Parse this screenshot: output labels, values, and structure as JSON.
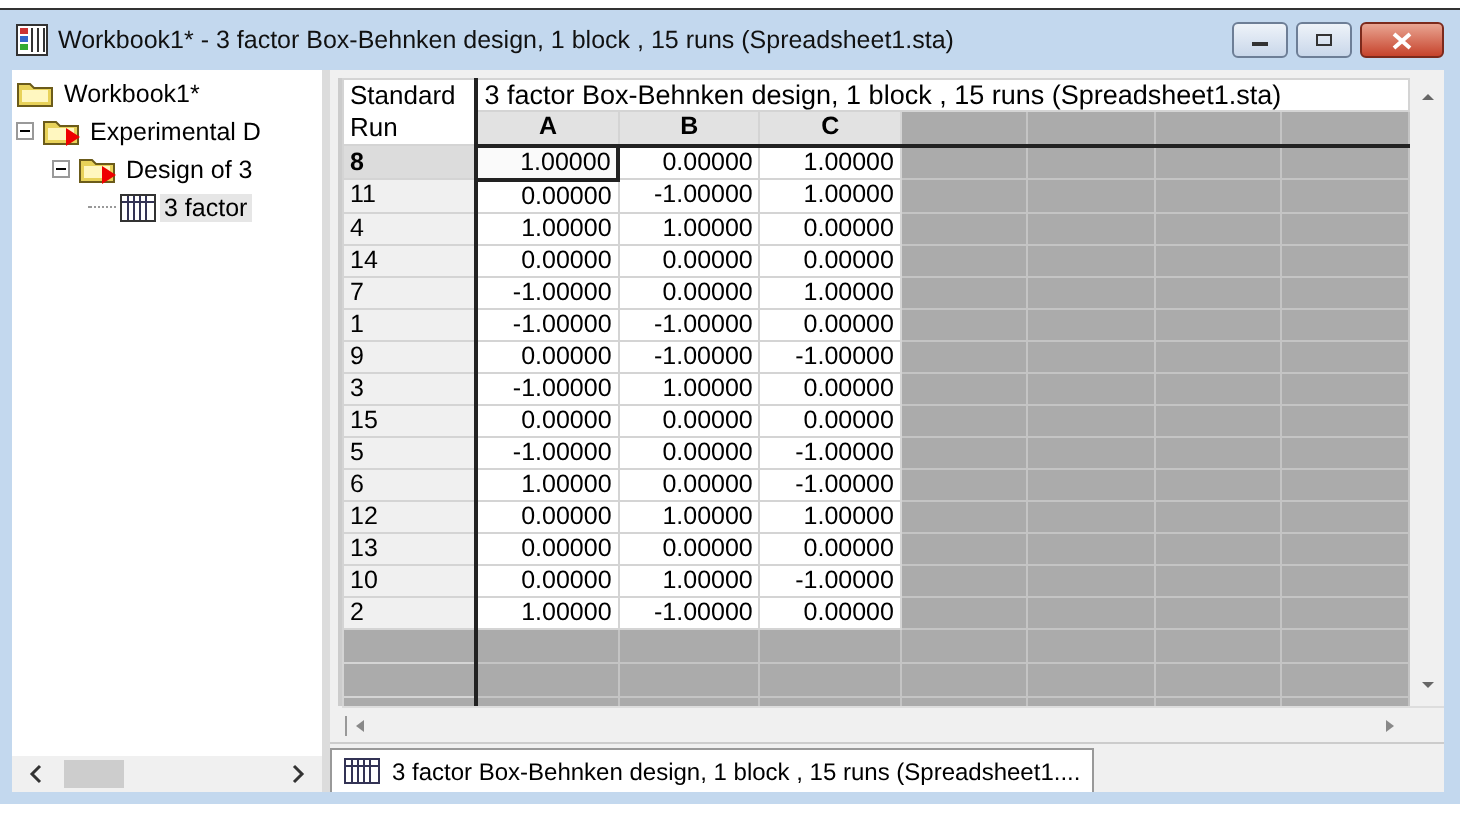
{
  "window": {
    "title": "Workbook1* - 3 factor Box-Behnken design, 1 block , 15 runs (Spreadsheet1.sta)"
  },
  "tree": [
    {
      "label": "Workbook1*",
      "kind": "folder",
      "selected": false,
      "children": [
        {
          "label": "Experimental D",
          "kind": "design",
          "expanded": true,
          "selected": false,
          "children": [
            {
              "label": "Design of 3",
              "kind": "design",
              "expanded": true,
              "selected": false,
              "children": [
                {
                  "label": "3 factor",
                  "kind": "sheet",
                  "selected": true
                }
              ]
            }
          ]
        }
      ]
    }
  ],
  "table": {
    "corner": [
      "Standard",
      "Run"
    ],
    "title": "3 factor Box-Behnken design, 1 block , 15 runs (Spreadsheet1.sta)",
    "columns": [
      "A",
      "B",
      "C"
    ],
    "rows": [
      {
        "label": "8",
        "cells": [
          {
            "value": "1.00000",
            "selected": true
          },
          {
            "value": "0.00000",
            "selected": false
          },
          {
            "value": "1.00000",
            "selected": false
          }
        ]
      },
      {
        "label": "11",
        "cells": [
          {
            "value": "0.00000",
            "selected": false
          },
          {
            "value": "-1.00000",
            "selected": false
          },
          {
            "value": "1.00000",
            "selected": false
          }
        ]
      },
      {
        "label": "4",
        "cells": [
          {
            "value": "1.00000",
            "selected": false
          },
          {
            "value": "1.00000",
            "selected": false
          },
          {
            "value": "0.00000",
            "selected": false
          }
        ]
      },
      {
        "label": "14",
        "cells": [
          {
            "value": "0.00000",
            "selected": false
          },
          {
            "value": "0.00000",
            "selected": false
          },
          {
            "value": "0.00000",
            "selected": false
          }
        ]
      },
      {
        "label": "7",
        "cells": [
          {
            "value": "-1.00000",
            "selected": false
          },
          {
            "value": "0.00000",
            "selected": false
          },
          {
            "value": "1.00000",
            "selected": false
          }
        ]
      },
      {
        "label": "1",
        "cells": [
          {
            "value": "-1.00000",
            "selected": false
          },
          {
            "value": "-1.00000",
            "selected": false
          },
          {
            "value": "0.00000",
            "selected": false
          }
        ]
      },
      {
        "label": "9",
        "cells": [
          {
            "value": "0.00000",
            "selected": false
          },
          {
            "value": "-1.00000",
            "selected": false
          },
          {
            "value": "-1.00000",
            "selected": false
          }
        ]
      },
      {
        "label": "3",
        "cells": [
          {
            "value": "-1.00000",
            "selected": false
          },
          {
            "value": "1.00000",
            "selected": false
          },
          {
            "value": "0.00000",
            "selected": false
          }
        ]
      },
      {
        "label": "15",
        "cells": [
          {
            "value": "0.00000",
            "selected": false
          },
          {
            "value": "0.00000",
            "selected": false
          },
          {
            "value": "0.00000",
            "selected": false
          }
        ]
      },
      {
        "label": "5",
        "cells": [
          {
            "value": "-1.00000",
            "selected": false
          },
          {
            "value": "0.00000",
            "selected": false
          },
          {
            "value": "-1.00000",
            "selected": false
          }
        ]
      },
      {
        "label": "6",
        "cells": [
          {
            "value": "1.00000",
            "selected": false
          },
          {
            "value": "0.00000",
            "selected": false
          },
          {
            "value": "-1.00000",
            "selected": false
          }
        ]
      },
      {
        "label": "12",
        "cells": [
          {
            "value": "0.00000",
            "selected": false
          },
          {
            "value": "1.00000",
            "selected": false
          },
          {
            "value": "1.00000",
            "selected": false
          }
        ]
      },
      {
        "label": "13",
        "cells": [
          {
            "value": "0.00000",
            "selected": false
          },
          {
            "value": "0.00000",
            "selected": false
          },
          {
            "value": "0.00000",
            "selected": false
          }
        ]
      },
      {
        "label": "10",
        "cells": [
          {
            "value": "0.00000",
            "selected": false
          },
          {
            "value": "1.00000",
            "selected": false
          },
          {
            "value": "-1.00000",
            "selected": false
          }
        ]
      },
      {
        "label": "2",
        "cells": [
          {
            "value": "1.00000",
            "selected": false
          },
          {
            "value": "-1.00000",
            "selected": false
          },
          {
            "value": "0.00000",
            "selected": false
          }
        ]
      }
    ]
  },
  "tabs": [
    {
      "label": "3 factor Box-Behnken design, 1 block , 15 runs (Spreadsheet1....",
      "selected": true
    }
  ]
}
